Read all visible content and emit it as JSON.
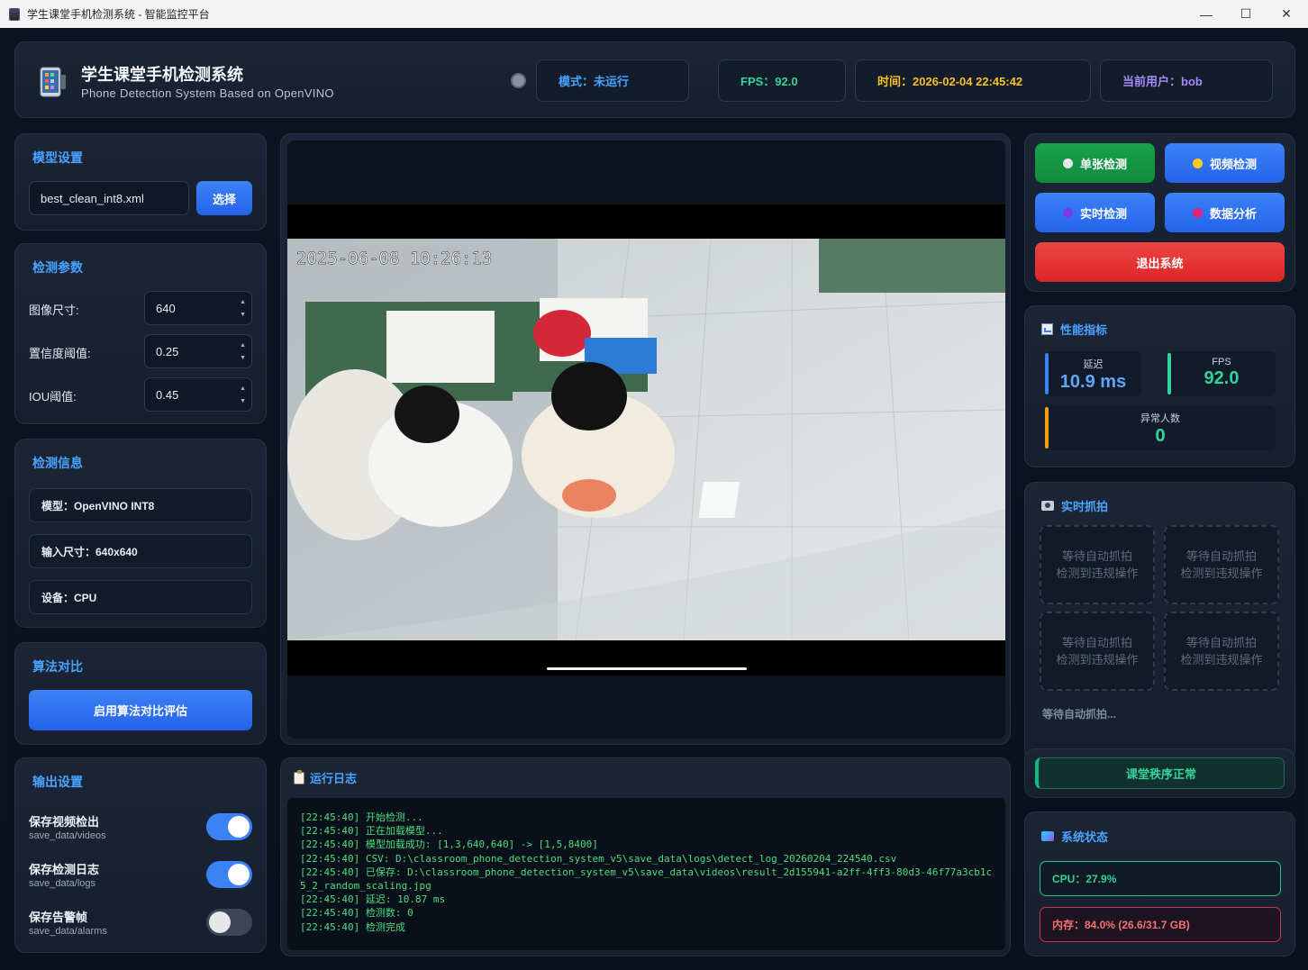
{
  "window": {
    "title": "学生课堂手机检测系统 - 智能监控平台",
    "minimize": "—",
    "maximize": "☐",
    "close": "✕"
  },
  "header": {
    "title": "学生课堂手机检测系统",
    "subtitle": "Phone Detection System Based on OpenVINO",
    "mode": "模式：未运行",
    "fps": "FPS：92.0",
    "time": "时间：2026-02-04 22:45:42",
    "user": "当前用户：bob"
  },
  "model_settings": {
    "title": "模型设置",
    "model_file": "best_clean_int8.xml",
    "select_label": "选择"
  },
  "detect_params": {
    "title": "检测参数",
    "image_size_label": "图像尺寸:",
    "image_size": "640",
    "conf_label": "置信度阈值:",
    "conf": "0.25",
    "iou_label": "IOU阈值:",
    "iou": "0.45"
  },
  "detect_info": {
    "title": "检测信息",
    "model": "模型：OpenVINO INT8",
    "input_size": "输入尺寸：640x640",
    "device": "设备：CPU"
  },
  "algo_compare": {
    "title": "算法对比",
    "button": "启用算法对比评估"
  },
  "output_settings": {
    "title": "输出设置",
    "items": [
      {
        "label": "保存视频检出",
        "path": "save_data/videos",
        "on": true
      },
      {
        "label": "保存检测日志",
        "path": "save_data/logs",
        "on": true
      },
      {
        "label": "保存告警帧",
        "path": "save_data/alarms",
        "on": false
      }
    ]
  },
  "video": {
    "timestamp": "2025-06-08  10:26:13"
  },
  "log": {
    "title": "运行日志",
    "lines": [
      "[22:45:40] 开始检测...",
      "[22:45:40] 正在加载模型...",
      "[22:45:40] 模型加载成功: [1,3,640,640] -> [1,5,8400]",
      "[22:45:40] CSV: D:\\classroom_phone_detection_system_v5\\save_data\\logs\\detect_log_20260204_224540.csv",
      "[22:45:40] 已保存: D:\\classroom_phone_detection_system_v5\\save_data\\videos\\result_2d155941-a2ff-4ff3-80d3-46f77a3cb1c5_2_random_scaling.jpg",
      "[22:45:40] 延迟: 10.87 ms",
      "[22:45:40] 检测数: 0",
      "[22:45:40] 检测完成"
    ]
  },
  "actions": {
    "single": "单张检测",
    "video": "视频检测",
    "realtime": "实时检测",
    "analysis": "数据分析",
    "exit": "退出系统",
    "colors": {
      "single": "#16a34a",
      "video": "#2563eb",
      "realtime": "#2563eb",
      "analysis": "#2563eb",
      "exit": "#dc2626"
    }
  },
  "performance": {
    "title": "性能指标",
    "latency_label": "延迟",
    "latency": "10.9 ms",
    "fps_label": "FPS",
    "fps": "92.0",
    "abnormal_label": "异常人数",
    "abnormal": "0"
  },
  "snapshots": {
    "title": "实时抓拍",
    "slot_line1": "等待自动抓拍",
    "slot_line2": "检测到违规操作",
    "status": "等待自动抓拍..."
  },
  "classroom_status": "课堂秩序正常",
  "system_status": {
    "title": "系统状态",
    "cpu": "CPU：27.9%",
    "memory": "内存：84.0% (26.6/31.7 GB)"
  }
}
